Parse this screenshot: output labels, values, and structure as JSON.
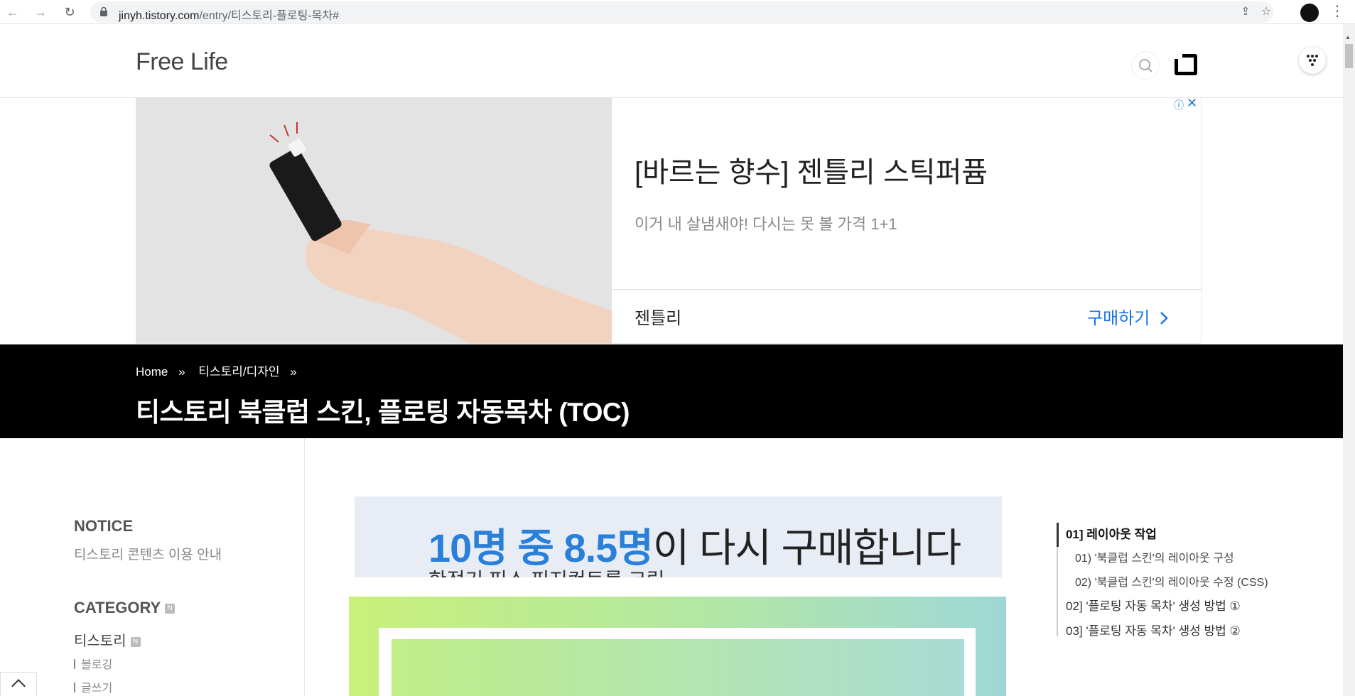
{
  "browser": {
    "url_host": "jinyh.tistory.com",
    "url_path": "/entry/티스토리-플로팅-목차#"
  },
  "header": {
    "blog_title": "Free Life"
  },
  "ad": {
    "headline": "[바르는 향수] 젠틀리 스틱퍼퓸",
    "description": "이거 내 살냄새야! 다시는 못 볼 가격 1+1",
    "advertiser": "젠틀리",
    "cta": "구매하기",
    "info_icon": "ⓘ",
    "close_icon": "✕"
  },
  "post": {
    "breadcrumb": [
      "Home",
      "티스토리/디자인"
    ],
    "breadcrumb_sep": "»",
    "title": "티스토리 북클럽 스킨, 플로팅 자동목차 (TOC)"
  },
  "sidebar": {
    "notice_heading": "NOTICE",
    "notice_link": "티스토리 콘텐츠 이용 안내",
    "category_heading": "CATEGORY",
    "new_badge": "N",
    "category": "티스토리",
    "subcategories": [
      "블로깅",
      "글쓰기"
    ]
  },
  "content_ad": {
    "highlight": "10명 중 8.5명",
    "text": "이 다시 구매합니다",
    "sub": "한정기 피스 피지컨트롤 크림"
  },
  "toc": {
    "items": [
      {
        "label": "01] 레이아웃 작업",
        "level": 1,
        "active": true
      },
      {
        "label": "01) '북클럽 스킨'의 레이아웃 구성",
        "level": 2
      },
      {
        "label": "02) '북클럽 스킨'의 레이아웃 수정 (CSS)",
        "level": 2
      },
      {
        "label": "02] '플로팅 자동 목차' 생성 방법 ①",
        "level": 1
      },
      {
        "label": "03] '플로팅 자동 목차' 생성 방법 ②",
        "level": 1
      }
    ]
  },
  "colors": {
    "ad_cta": "#1a73e8",
    "title_band": "#000000",
    "content_ad_highlight": "#2a80d8"
  }
}
